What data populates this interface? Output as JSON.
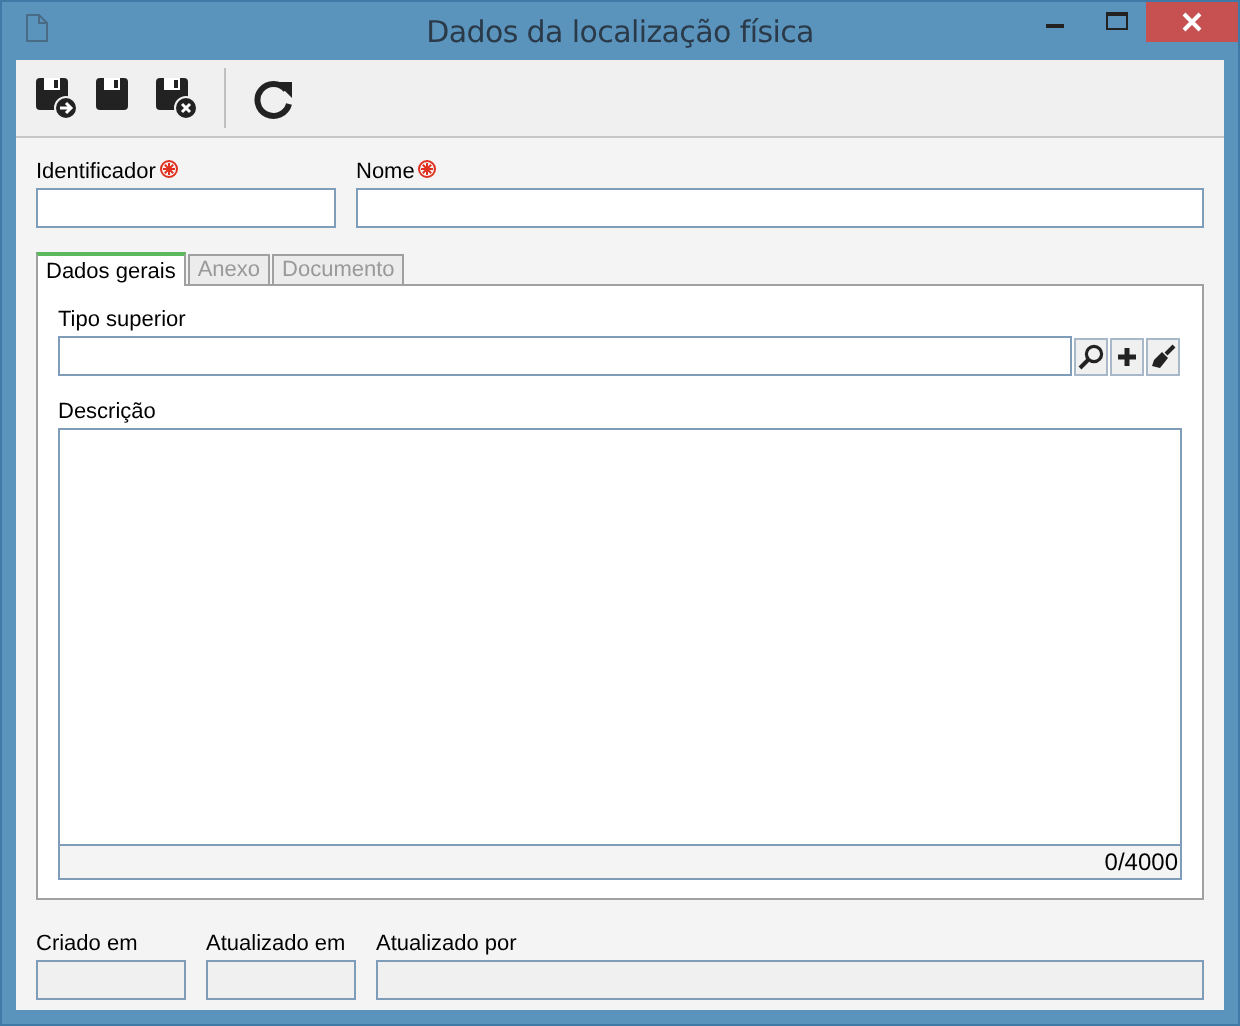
{
  "window": {
    "title": "Dados da localização física"
  },
  "fields": [
    {
      "label": "Identificador",
      "required": true
    },
    {
      "label": "Nome",
      "required": true
    }
  ],
  "tabs": [
    {
      "label": "Dados gerais",
      "selected": true,
      "disabled": false
    },
    {
      "label": "Anexo",
      "selected": false,
      "disabled": true
    },
    {
      "label": "Documento",
      "selected": false,
      "disabled": true
    }
  ],
  "tab_panel": {
    "parent_type": {
      "label": "Tipo superior"
    },
    "description": {
      "label": "Descrição",
      "counter": "0/4000"
    }
  },
  "footer_fields": [
    {
      "label": "Criado em",
      "disabled": true
    },
    {
      "label": "Atualizado em",
      "disabled": true
    },
    {
      "label": "Atualizado por",
      "disabled": true
    }
  ]
}
